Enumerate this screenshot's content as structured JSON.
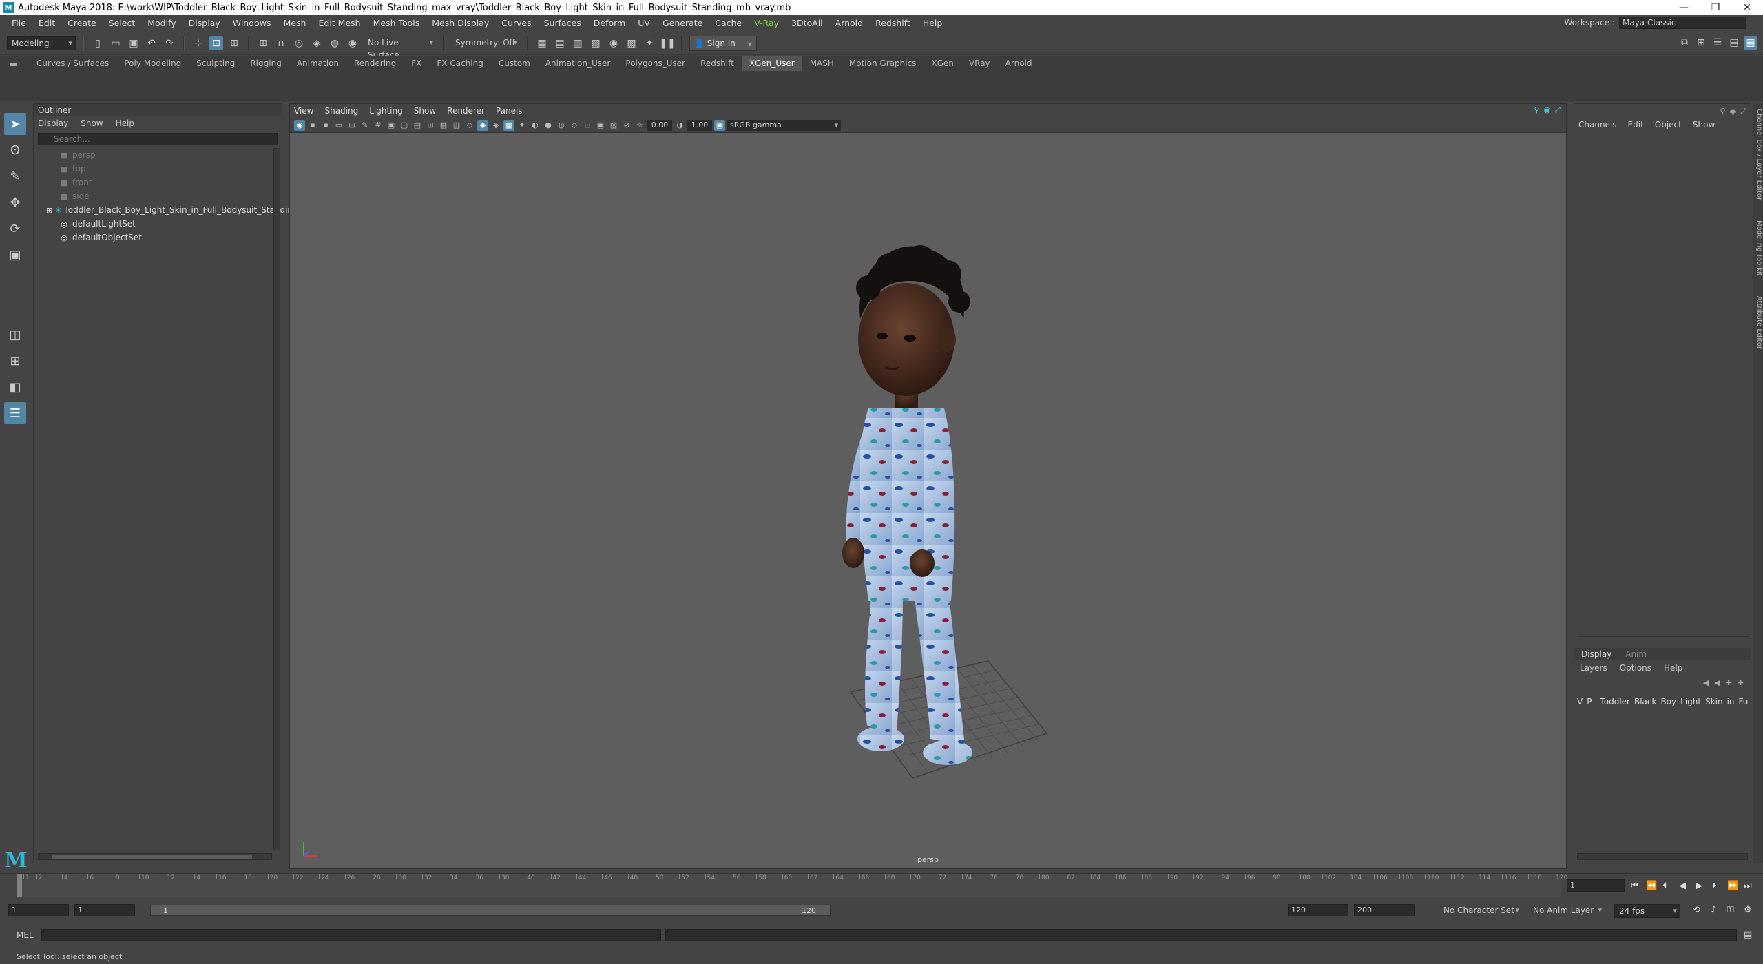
{
  "window": {
    "title": "Autodesk Maya 2018: E:\\work\\WIP\\Toddler_Black_Boy_Light_Skin_in_Full_Bodysuit_Standing_max_vray\\Toddler_Black_Boy_Light_Skin_in_Full_Bodysuit_Standing_mb_vray.mb",
    "logo": "M",
    "minimize": "—",
    "restore": "❐",
    "close": "✕"
  },
  "menubar": [
    "File",
    "Edit",
    "Create",
    "Select",
    "Modify",
    "Display",
    "Windows",
    "Mesh",
    "Edit Mesh",
    "Mesh Tools",
    "Mesh Display",
    "Curves",
    "Surfaces",
    "Deform",
    "UV",
    "Generate",
    "Cache",
    "V-Ray",
    "3DtoAll",
    "Arnold",
    "Redshift",
    "Help"
  ],
  "workspace": {
    "label": "Workspace :",
    "value": "Maya Classic"
  },
  "statusline": {
    "mode": "Modeling",
    "live_surface": "No Live Surface",
    "symmetry": "Symmetry: Off",
    "sign_in": "Sign In"
  },
  "shelf_tabs": [
    "Curves / Surfaces",
    "Poly Modeling",
    "Sculpting",
    "Rigging",
    "Animation",
    "Rendering",
    "FX",
    "FX Caching",
    "Custom",
    "Animation_User",
    "Polygons_User",
    "Redshift",
    "XGen_User",
    "MASH",
    "Motion Graphics",
    "XGen",
    "VRay",
    "Arnold"
  ],
  "shelf_active": "XGen_User",
  "outliner": {
    "title": "Outliner",
    "menu": [
      "Display",
      "Show",
      "Help"
    ],
    "search_placeholder": "Search...",
    "items": [
      {
        "label": "persp",
        "dim": true
      },
      {
        "label": "top",
        "dim": true
      },
      {
        "label": "front",
        "dim": true
      },
      {
        "label": "side",
        "dim": true
      },
      {
        "label": "Toddler_Black_Boy_Light_Skin_in_Full_Bodysuit_Standing",
        "dim": false
      },
      {
        "label": "defaultLightSet",
        "dim": false
      },
      {
        "label": "defaultObjectSet",
        "dim": false
      }
    ]
  },
  "viewport": {
    "menu": [
      "View",
      "Shading",
      "Lighting",
      "Show",
      "Renderer",
      "Panels"
    ],
    "exposure": "0.00",
    "gamma": "1.00",
    "color_space": "sRGB gamma",
    "camera_label": "persp"
  },
  "channelbox": {
    "menu": [
      "Channels",
      "Edit",
      "Object",
      "Show"
    ],
    "layer_tabs": [
      "Display",
      "Anim"
    ],
    "layer_menu": [
      "Layers",
      "Options",
      "Help"
    ],
    "layer": {
      "v": "V",
      "p": "P",
      "name": "Toddler_Black_Boy_Light_Skin_in_Full",
      "color": "#b0163a"
    },
    "side_tabs": [
      "Channel Box / Layer Editor",
      "Modeling Toolkit",
      "Attribute Editor"
    ]
  },
  "timeline": {
    "ticks": [
      "1",
      "2",
      "4",
      "6",
      "8",
      "10",
      "12",
      "14",
      "16",
      "18",
      "20",
      "22",
      "24",
      "26",
      "28",
      "30",
      "32",
      "34",
      "36",
      "38",
      "40",
      "42",
      "44",
      "46",
      "48",
      "50",
      "52",
      "54",
      "56",
      "58",
      "60",
      "62",
      "64",
      "66",
      "68",
      "70",
      "72",
      "74",
      "76",
      "78",
      "80",
      "82",
      "84",
      "86",
      "88",
      "90",
      "92",
      "94",
      "96",
      "98",
      "100",
      "102",
      "104",
      "106",
      "108",
      "110",
      "112",
      "114",
      "116",
      "118",
      "120"
    ],
    "current_frame": "1"
  },
  "range": {
    "start": "1",
    "playback_start": "1",
    "bar_start": "1",
    "bar_end": "120",
    "playback_end": "120",
    "end": "200",
    "character_set": "No Character Set",
    "anim_layer": "No Anim Layer",
    "fps": "24 fps"
  },
  "cmdline": {
    "label": "MEL"
  },
  "helpline": "Select Tool: select an object"
}
